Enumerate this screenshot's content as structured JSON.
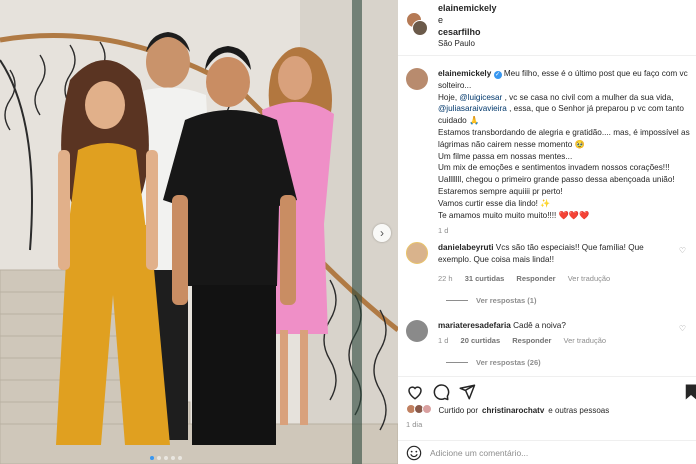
{
  "header": {
    "user1": "elainemickely",
    "conj": "e",
    "user2": "cesarfilho",
    "location": "São Paulo"
  },
  "caption": {
    "author": "elainemickely",
    "lines_first": " Meu filho, esse é o último post que eu faço com vc solteiro...",
    "line2_pre": "Hoje, ",
    "mention1": "@luigicesar",
    "line2_post": " , vc se casa no civil com a mulher da sua vida,",
    "mention2": "@juliasaraivavieira",
    "line3_post": " , essa, que o Senhor já preparou p vc com tanto cuidado 🙏",
    "line4": "Estamos transbordando de alegria e gratidão.... mas, é impossível as lágrimas não cairem nesse momento 🥹",
    "line5": "Um filme passa em nossas mentes...",
    "line6": "Um mix de emoções e sentimentos invadem nossos corações!!!",
    "line7": "Ualllllll, chegou o primeiro grande passo dessa abençoada união! Estaremos sempre aquiiii pr perto!",
    "line8": "Vamos curtir esse dia lindo! ✨",
    "line9": "Te amamos muito muito muito!!!! ❤️❤️❤️",
    "time": "1 d"
  },
  "comments": [
    {
      "user": "danielabeyruti",
      "text": " Vcs são tão especiais!! Que família! Que exemplo. Que coisa mais linda!!",
      "time": "22 h",
      "likes": "31 curtidas",
      "reply": "Responder",
      "translate": "Ver tradução",
      "replies": "Ver respostas (1)"
    },
    {
      "user": "mariateresadefaria",
      "text": " Cadê a noiva?",
      "time": "1 d",
      "likes": "20 curtidas",
      "reply": "Responder",
      "translate": "Ver tradução",
      "replies": "Ver respostas (26)"
    }
  ],
  "liked": {
    "prefix": "Curtido por",
    "user": "christinarochatv",
    "suffix": "e outras pessoas"
  },
  "post_date": "1 dia",
  "add_comment": {
    "placeholder": "Adicione um comentário..."
  },
  "colors": {
    "verified": "#3897f0",
    "link": "#00376b",
    "muted": "#8e8e8e",
    "yellow_outfit": "#e0a020",
    "pink_outfit": "#ef8fc7"
  },
  "icons": [
    "heart-icon",
    "comment-icon",
    "share-icon",
    "bookmark-icon",
    "emoji-icon",
    "chevron-right-icon"
  ]
}
